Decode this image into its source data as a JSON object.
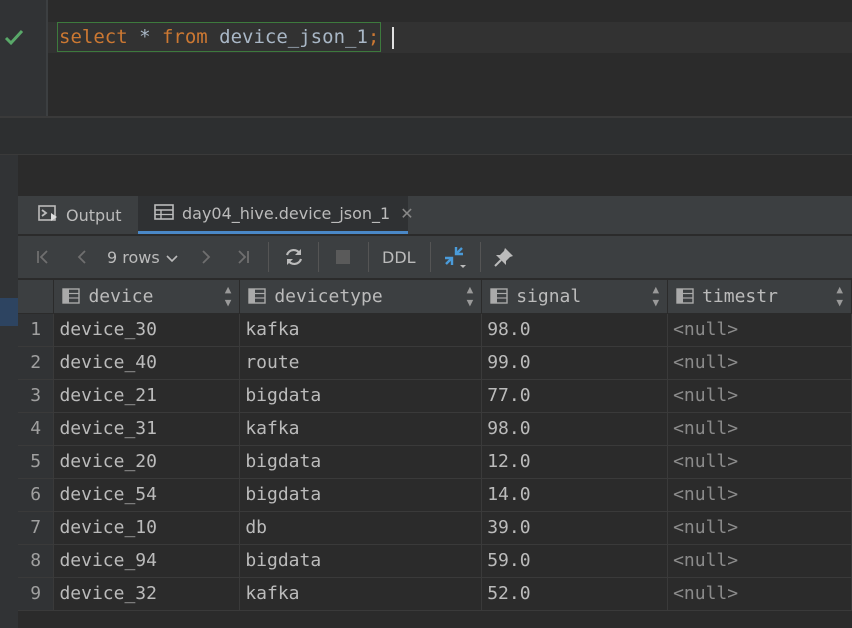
{
  "editor": {
    "query_parts": {
      "kw_select": "select",
      "star": " * ",
      "kw_from": "from",
      "table_name": " device_json_1",
      "semicolon": ";"
    }
  },
  "tabs": {
    "output_label": "Output",
    "result_label": "day04_hive.device_json_1",
    "close_glyph": "✕"
  },
  "toolbar": {
    "rows_label": "9 rows",
    "ddl_label": "DDL"
  },
  "table": {
    "columns": [
      "device",
      "devicetype",
      "signal",
      "timestr"
    ],
    "rows": [
      {
        "num": "1",
        "device": "device_30",
        "devicetype": "kafka",
        "signal": "98.0",
        "timestr": "<null>"
      },
      {
        "num": "2",
        "device": "device_40",
        "devicetype": "route",
        "signal": "99.0",
        "timestr": "<null>"
      },
      {
        "num": "3",
        "device": "device_21",
        "devicetype": "bigdata",
        "signal": "77.0",
        "timestr": "<null>"
      },
      {
        "num": "4",
        "device": "device_31",
        "devicetype": "kafka",
        "signal": "98.0",
        "timestr": "<null>"
      },
      {
        "num": "5",
        "device": "device_20",
        "devicetype": "bigdata",
        "signal": "12.0",
        "timestr": "<null>"
      },
      {
        "num": "6",
        "device": "device_54",
        "devicetype": "bigdata",
        "signal": "14.0",
        "timestr": "<null>"
      },
      {
        "num": "7",
        "device": "device_10",
        "devicetype": "db",
        "signal": "39.0",
        "timestr": "<null>"
      },
      {
        "num": "8",
        "device": "device_94",
        "devicetype": "bigdata",
        "signal": "59.0",
        "timestr": "<null>"
      },
      {
        "num": "9",
        "device": "device_32",
        "devicetype": "kafka",
        "signal": "52.0",
        "timestr": "<null>"
      }
    ]
  },
  "colors": {
    "keyword": "#cc7832",
    "identifier": "#a9b7c6",
    "accent": "#4a88c7",
    "success": "#59a869"
  }
}
